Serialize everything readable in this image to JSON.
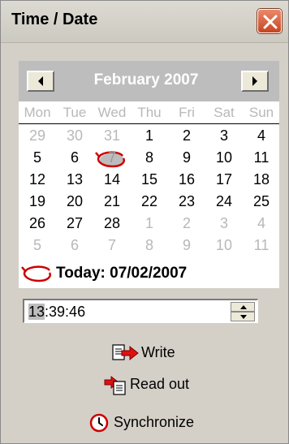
{
  "window": {
    "title": "Time / Date"
  },
  "calendar": {
    "month_title": "February 2007",
    "weekdays": [
      "Mon",
      "Tue",
      "Wed",
      "Thu",
      "Fri",
      "Sat",
      "Sun"
    ],
    "weeks": [
      [
        "29",
        "30",
        "31",
        "1",
        "2",
        "3",
        "4"
      ],
      [
        "5",
        "6",
        "7",
        "8",
        "9",
        "10",
        "11"
      ],
      [
        "12",
        "13",
        "14",
        "15",
        "16",
        "17",
        "18"
      ],
      [
        "19",
        "20",
        "21",
        "22",
        "23",
        "24",
        "25"
      ],
      [
        "26",
        "27",
        "28",
        "1",
        "2",
        "3",
        "4"
      ],
      [
        "5",
        "6",
        "7",
        "8",
        "9",
        "10",
        "11"
      ]
    ],
    "today_label": "Today: 07/02/2007",
    "today_ring_color": "#cc0000"
  },
  "time": {
    "value_hours": "13",
    "value_rest": ":39:46"
  },
  "actions": {
    "write": "Write",
    "read_out": "Read out",
    "synchronize": "Synchronize"
  },
  "colors": {
    "header_gray": "#bdbdbd",
    "window_bg": "#d4d0c8",
    "close_red": "#c7451f"
  }
}
